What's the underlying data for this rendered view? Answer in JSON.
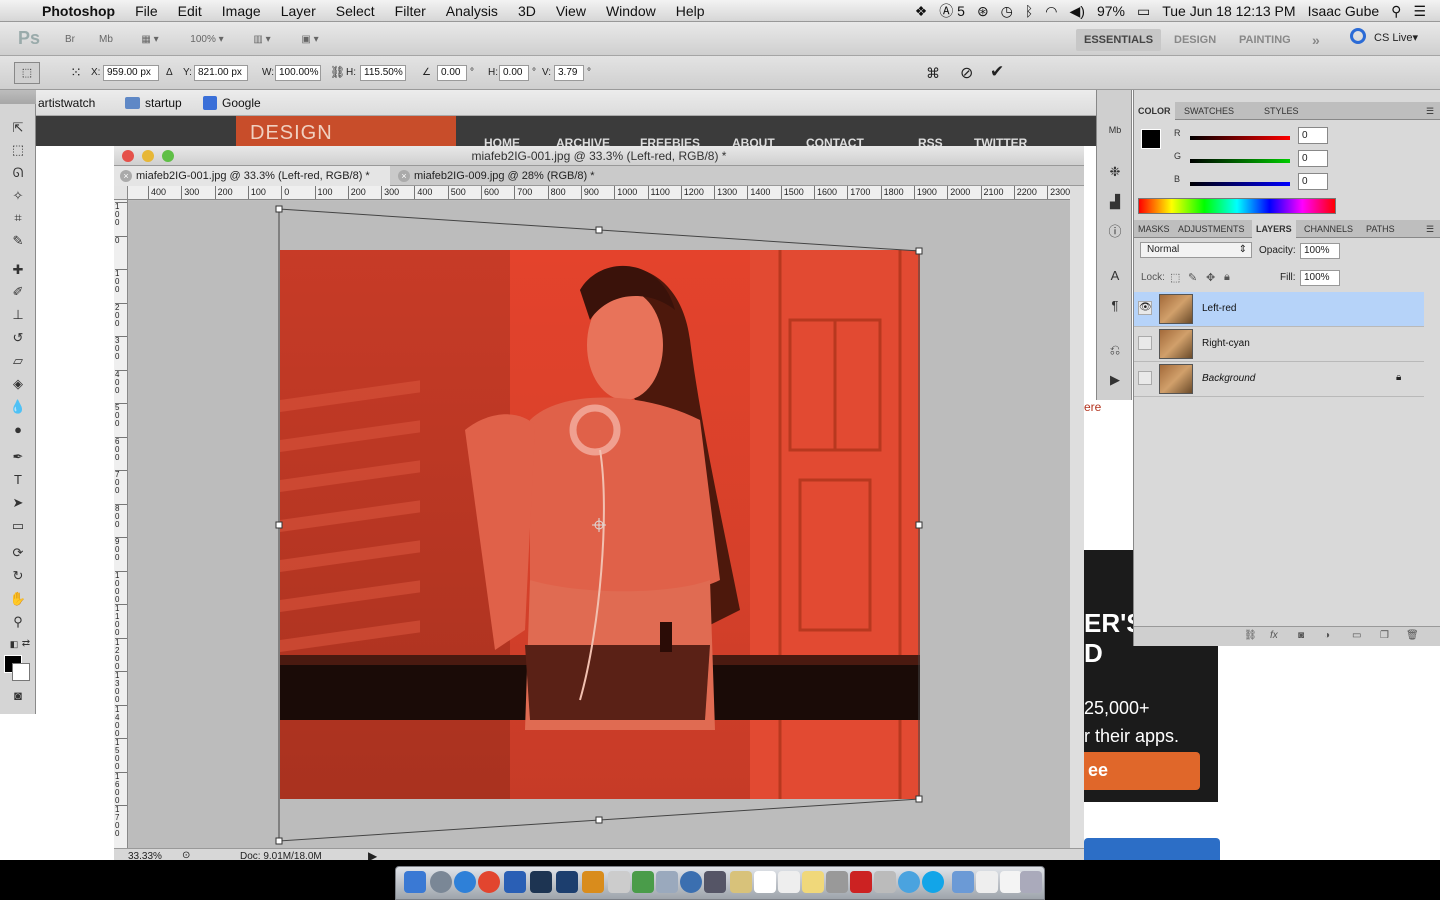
{
  "menubar": {
    "app": "Photoshop",
    "items": [
      "File",
      "Edit",
      "Image",
      "Layer",
      "Select",
      "Filter",
      "Analysis",
      "3D",
      "View",
      "Window",
      "Help"
    ],
    "status": {
      "adobe_count": "5",
      "battery": "97%",
      "datetime": "Tue Jun 18  12:13 PM",
      "user": "Isaac Gube"
    }
  },
  "appbar": {
    "logo": "Ps",
    "bridge": "Br",
    "minibridge": "Mb",
    "zoom": "100%",
    "workspaces": [
      "ESSENTIALS",
      "DESIGN",
      "PAINTING"
    ],
    "more": "»",
    "cs_live": "CS Live"
  },
  "options": {
    "x_label": "X:",
    "x_value": "959.00 px",
    "y_label": "Y:",
    "y_value": "821.00 px",
    "w_label": "W:",
    "w_value": "100.00%",
    "h_label": "H:",
    "h_value": "115.50%",
    "angle_value": "0.00",
    "angle_unit": "°",
    "hskew_label": "H:",
    "hskew_value": "0.00",
    "hskew_unit": "°",
    "vskew_label": "V:",
    "vskew_value": "3.79",
    "vskew_unit": "°"
  },
  "browser": {
    "bookmarks": [
      "artistwatch",
      "startup",
      "Google"
    ],
    "site_logo": "DESIGN INSTRUCT",
    "nav": [
      "HOME",
      "ARCHIVE",
      "FREEBIES",
      "ABOUT",
      "CONTACT",
      "RSS",
      "TWITTER"
    ],
    "link_text": "ere",
    "ad": {
      "t1": "ER'S",
      "t1b": "D",
      "t2": "25,000+",
      "t3": "r their apps.",
      "btn": "ee"
    }
  },
  "document": {
    "title": "miafeb2IG-001.jpg @ 33.3% (Left-red, RGB/8) *",
    "tabs": [
      "miafeb2IG-001.jpg @ 33.3% (Left-red, RGB/8) *",
      "miafeb2IG-009.jpg @ 28% (RGB/8) *"
    ],
    "ruler_top": [
      "400",
      "300",
      "200",
      "100",
      "0",
      "100",
      "200",
      "300",
      "400",
      "500",
      "600",
      "700",
      "800",
      "900",
      "1000",
      "1100",
      "1200",
      "1300",
      "1400",
      "1500",
      "1600",
      "1700",
      "1800",
      "1900",
      "2000",
      "2100",
      "2200",
      "2300"
    ],
    "ruler_left": [
      "1\n0\n0",
      "0",
      "1\n0\n0",
      "2\n0\n0",
      "3\n0\n0",
      "4\n0\n0",
      "5\n0\n0",
      "6\n0\n0",
      "7\n0\n0",
      "8\n0\n0",
      "9\n0\n0",
      "1\n0\n0\n0",
      "1\n1\n0\n0",
      "1\n2\n0\n0",
      "1\n3\n0\n0",
      "1\n4\n0\n0",
      "1\n5\n0\n0",
      "1\n6\n0\n0",
      "1\n7\n0\n0"
    ],
    "zoom": "33.33%",
    "doc_size": "Doc: 9.01M/18.0M"
  },
  "panels": {
    "color_tabs": [
      "COLOR",
      "SWATCHES",
      "STYLES"
    ],
    "color_channels": [
      {
        "label": "R",
        "value": "0"
      },
      {
        "label": "G",
        "value": "0"
      },
      {
        "label": "B",
        "value": "0"
      }
    ],
    "layer_tabs": [
      "MASKS",
      "ADJUSTMENTS",
      "LAYERS",
      "CHANNELS",
      "PATHS"
    ],
    "blend_mode": "Normal",
    "opacity_label": "Opacity:",
    "opacity": "100%",
    "lock_label": "Lock:",
    "fill_label": "Fill:",
    "fill": "100%",
    "layers": [
      {
        "name": "Left-red",
        "visible": true,
        "selected": true
      },
      {
        "name": "Right-cyan",
        "visible": false,
        "selected": false
      },
      {
        "name": "Background",
        "visible": false,
        "selected": false
      }
    ],
    "footer_icons": [
      "link-icon",
      "fx-icon",
      "mask-icon",
      "adjustment-icon",
      "folder-icon",
      "new-layer-icon",
      "trash-icon"
    ]
  },
  "colors": {
    "photo_red": "#e4432c",
    "selection": "#b6d3f9",
    "brand_orange": "#c84d2a"
  }
}
